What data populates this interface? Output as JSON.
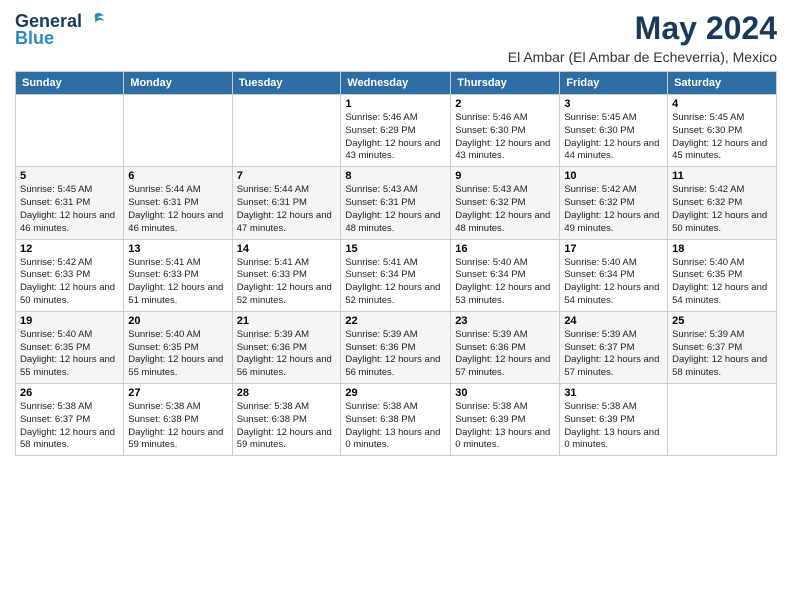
{
  "logo": {
    "line1": "General",
    "line2": "Blue"
  },
  "title": "May 2024",
  "subtitle": "El Ambar (El Ambar de Echeverria), Mexico",
  "days_header": [
    "Sunday",
    "Monday",
    "Tuesday",
    "Wednesday",
    "Thursday",
    "Friday",
    "Saturday"
  ],
  "weeks": [
    [
      {
        "num": "",
        "info": ""
      },
      {
        "num": "",
        "info": ""
      },
      {
        "num": "",
        "info": ""
      },
      {
        "num": "1",
        "info": "Sunrise: 5:46 AM\nSunset: 6:29 PM\nDaylight: 12 hours and 43 minutes."
      },
      {
        "num": "2",
        "info": "Sunrise: 5:46 AM\nSunset: 6:30 PM\nDaylight: 12 hours and 43 minutes."
      },
      {
        "num": "3",
        "info": "Sunrise: 5:45 AM\nSunset: 6:30 PM\nDaylight: 12 hours and 44 minutes."
      },
      {
        "num": "4",
        "info": "Sunrise: 5:45 AM\nSunset: 6:30 PM\nDaylight: 12 hours and 45 minutes."
      }
    ],
    [
      {
        "num": "5",
        "info": "Sunrise: 5:45 AM\nSunset: 6:31 PM\nDaylight: 12 hours and 46 minutes."
      },
      {
        "num": "6",
        "info": "Sunrise: 5:44 AM\nSunset: 6:31 PM\nDaylight: 12 hours and 46 minutes."
      },
      {
        "num": "7",
        "info": "Sunrise: 5:44 AM\nSunset: 6:31 PM\nDaylight: 12 hours and 47 minutes."
      },
      {
        "num": "8",
        "info": "Sunrise: 5:43 AM\nSunset: 6:31 PM\nDaylight: 12 hours and 48 minutes."
      },
      {
        "num": "9",
        "info": "Sunrise: 5:43 AM\nSunset: 6:32 PM\nDaylight: 12 hours and 48 minutes."
      },
      {
        "num": "10",
        "info": "Sunrise: 5:42 AM\nSunset: 6:32 PM\nDaylight: 12 hours and 49 minutes."
      },
      {
        "num": "11",
        "info": "Sunrise: 5:42 AM\nSunset: 6:32 PM\nDaylight: 12 hours and 50 minutes."
      }
    ],
    [
      {
        "num": "12",
        "info": "Sunrise: 5:42 AM\nSunset: 6:33 PM\nDaylight: 12 hours and 50 minutes."
      },
      {
        "num": "13",
        "info": "Sunrise: 5:41 AM\nSunset: 6:33 PM\nDaylight: 12 hours and 51 minutes."
      },
      {
        "num": "14",
        "info": "Sunrise: 5:41 AM\nSunset: 6:33 PM\nDaylight: 12 hours and 52 minutes."
      },
      {
        "num": "15",
        "info": "Sunrise: 5:41 AM\nSunset: 6:34 PM\nDaylight: 12 hours and 52 minutes."
      },
      {
        "num": "16",
        "info": "Sunrise: 5:40 AM\nSunset: 6:34 PM\nDaylight: 12 hours and 53 minutes."
      },
      {
        "num": "17",
        "info": "Sunrise: 5:40 AM\nSunset: 6:34 PM\nDaylight: 12 hours and 54 minutes."
      },
      {
        "num": "18",
        "info": "Sunrise: 5:40 AM\nSunset: 6:35 PM\nDaylight: 12 hours and 54 minutes."
      }
    ],
    [
      {
        "num": "19",
        "info": "Sunrise: 5:40 AM\nSunset: 6:35 PM\nDaylight: 12 hours and 55 minutes."
      },
      {
        "num": "20",
        "info": "Sunrise: 5:40 AM\nSunset: 6:35 PM\nDaylight: 12 hours and 55 minutes."
      },
      {
        "num": "21",
        "info": "Sunrise: 5:39 AM\nSunset: 6:36 PM\nDaylight: 12 hours and 56 minutes."
      },
      {
        "num": "22",
        "info": "Sunrise: 5:39 AM\nSunset: 6:36 PM\nDaylight: 12 hours and 56 minutes."
      },
      {
        "num": "23",
        "info": "Sunrise: 5:39 AM\nSunset: 6:36 PM\nDaylight: 12 hours and 57 minutes."
      },
      {
        "num": "24",
        "info": "Sunrise: 5:39 AM\nSunset: 6:37 PM\nDaylight: 12 hours and 57 minutes."
      },
      {
        "num": "25",
        "info": "Sunrise: 5:39 AM\nSunset: 6:37 PM\nDaylight: 12 hours and 58 minutes."
      }
    ],
    [
      {
        "num": "26",
        "info": "Sunrise: 5:38 AM\nSunset: 6:37 PM\nDaylight: 12 hours and 58 minutes."
      },
      {
        "num": "27",
        "info": "Sunrise: 5:38 AM\nSunset: 6:38 PM\nDaylight: 12 hours and 59 minutes."
      },
      {
        "num": "28",
        "info": "Sunrise: 5:38 AM\nSunset: 6:38 PM\nDaylight: 12 hours and 59 minutes."
      },
      {
        "num": "29",
        "info": "Sunrise: 5:38 AM\nSunset: 6:38 PM\nDaylight: 13 hours and 0 minutes."
      },
      {
        "num": "30",
        "info": "Sunrise: 5:38 AM\nSunset: 6:39 PM\nDaylight: 13 hours and 0 minutes."
      },
      {
        "num": "31",
        "info": "Sunrise: 5:38 AM\nSunset: 6:39 PM\nDaylight: 13 hours and 0 minutes."
      },
      {
        "num": "",
        "info": ""
      }
    ]
  ]
}
